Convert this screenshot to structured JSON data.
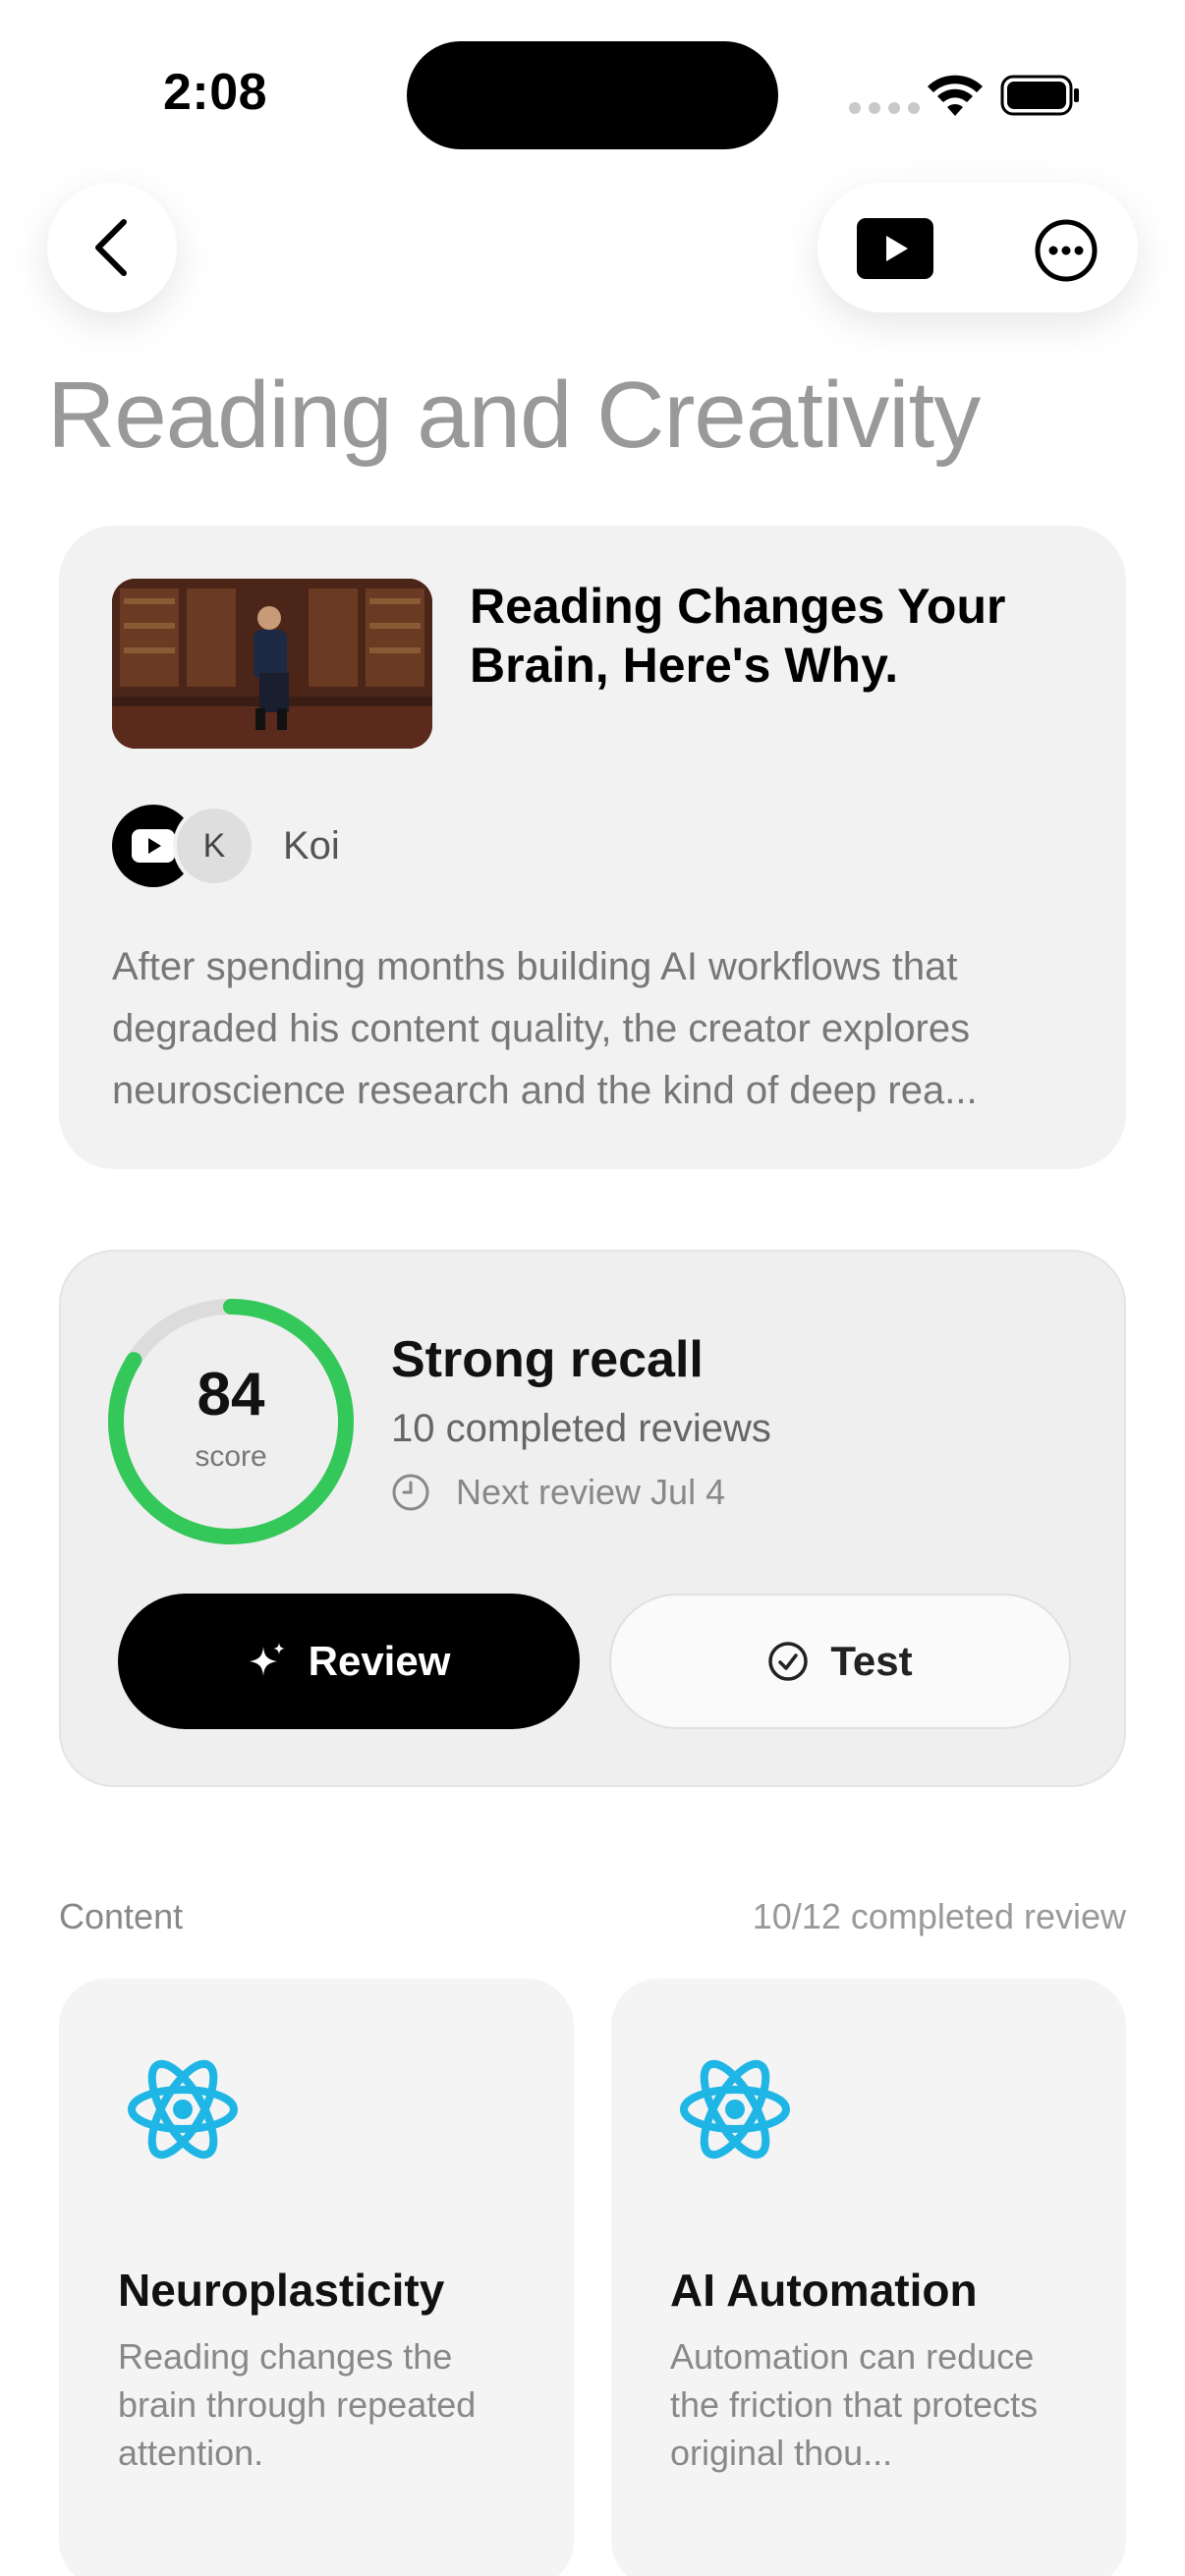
{
  "status_bar": {
    "time": "2:08"
  },
  "header": {
    "title": "Reading and Creativity"
  },
  "video": {
    "title": "Reading Changes Your Brain, Here's Why.",
    "avatar_letter": "K",
    "channel": "Koi",
    "description": "After spending months building AI workflows that degraded his content quality, the creator explores neuroscience research and the kind of deep rea..."
  },
  "recall": {
    "score": "84",
    "score_fraction": 0.84,
    "score_label": "score",
    "title": "Strong recall",
    "reviews": "10 completed reviews",
    "next_review": "Next review Jul 4",
    "review_label": "Review",
    "test_label": "Test"
  },
  "content": {
    "label": "Content",
    "progress": "10/12 completed review",
    "cards": [
      {
        "icon": "atom-icon",
        "title": "Neuroplasticity",
        "description": "Reading changes the brain through repeated attention."
      },
      {
        "icon": "atom-icon",
        "title": "AI Automation",
        "description": "Automation can reduce the friction that protects original thou..."
      }
    ]
  },
  "colors": {
    "accent_green": "#34c759",
    "atom_cyan": "#1fb6e6"
  }
}
